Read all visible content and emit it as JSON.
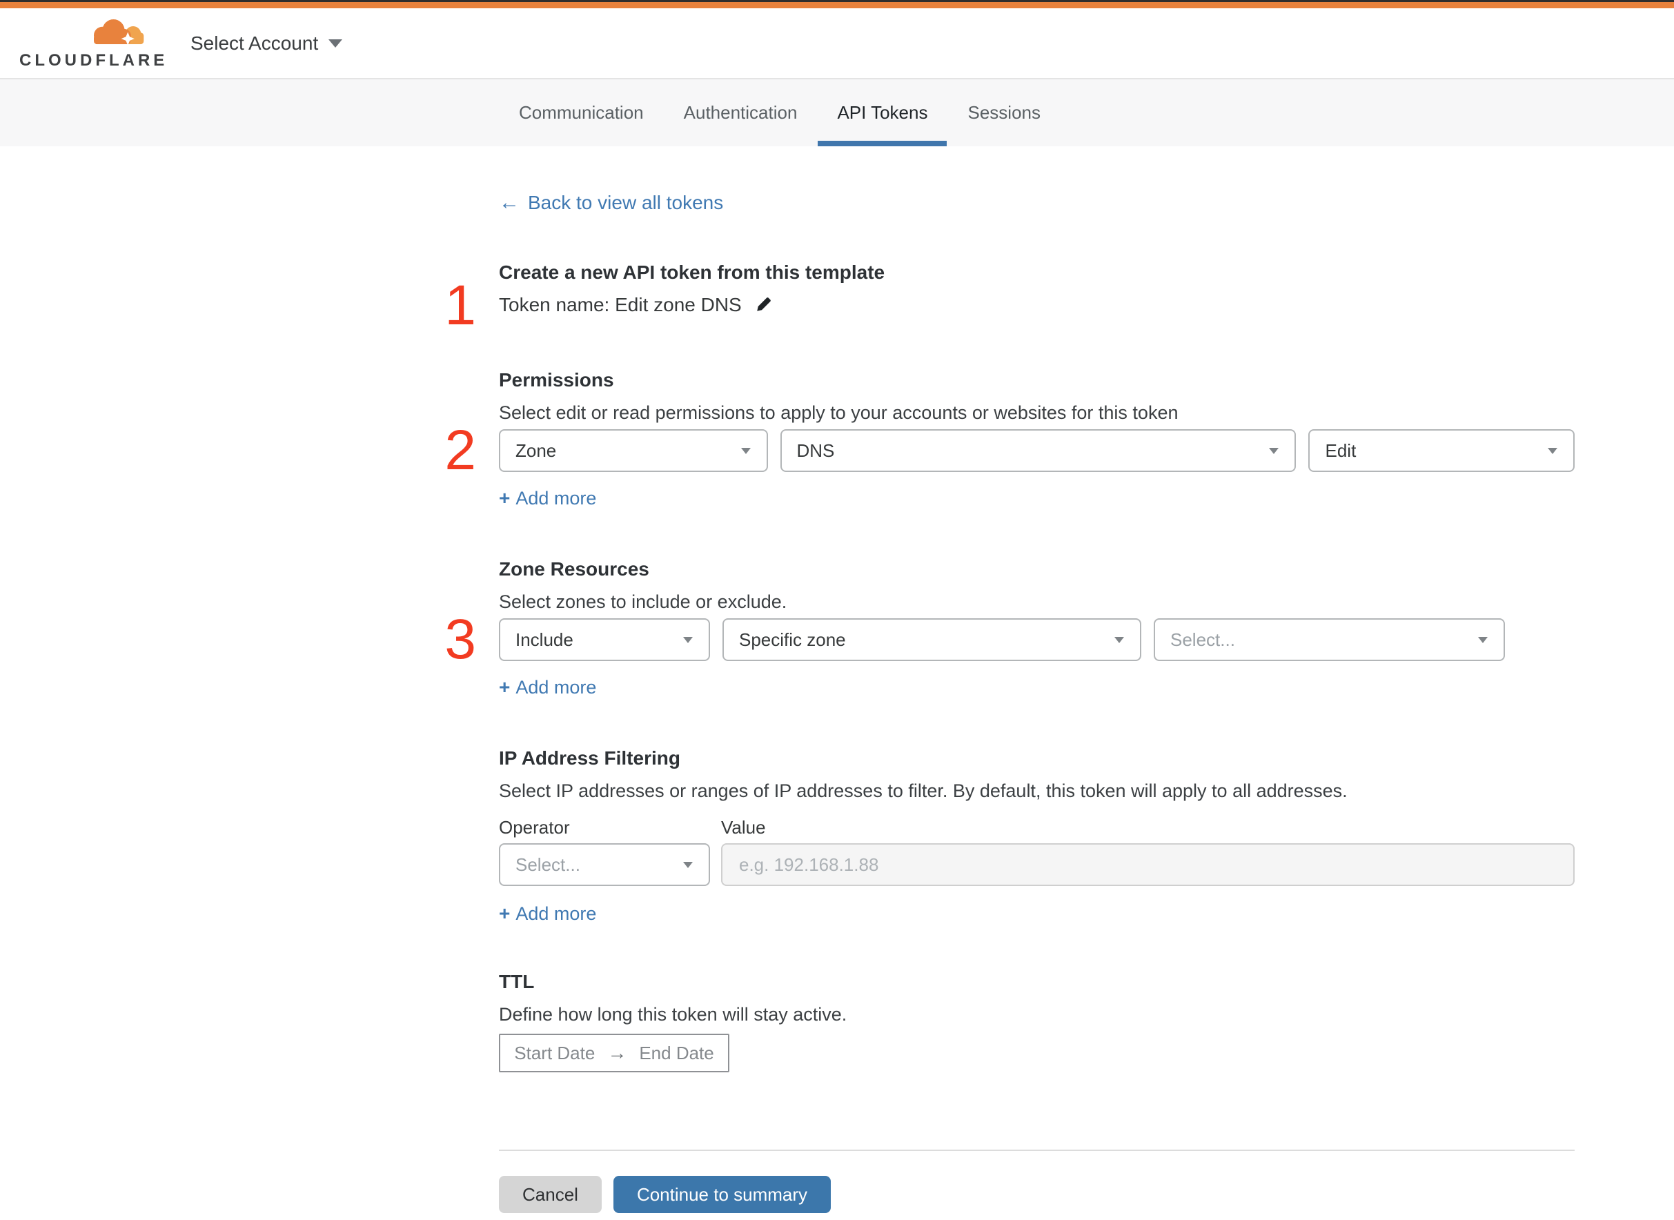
{
  "header": {
    "brand": "CLOUDFLARE",
    "account_selector": "Select Account"
  },
  "tabs": {
    "items": [
      {
        "label": "Communication"
      },
      {
        "label": "Authentication"
      },
      {
        "label": "API Tokens"
      },
      {
        "label": "Sessions"
      }
    ],
    "active": "API Tokens"
  },
  "back_link": {
    "arrow": "←",
    "label": "Back to view all tokens"
  },
  "steps": {
    "one": "1",
    "two": "2",
    "three": "3"
  },
  "template_section": {
    "heading": "Create a new API token from this template",
    "token_name": "Token name: Edit zone DNS"
  },
  "permissions": {
    "heading": "Permissions",
    "description": "Select edit or read permissions to apply to your accounts or websites for this token",
    "scope_select": "Zone",
    "resource_select": "DNS",
    "access_select": "Edit",
    "plus": "+",
    "add_more": "Add more"
  },
  "zone_resources": {
    "heading": "Zone Resources",
    "description": "Select zones to include or exclude.",
    "mode_select": "Include",
    "type_select": "Specific zone",
    "zone_select_placeholder": "Select...",
    "plus": "+",
    "add_more": "Add more"
  },
  "ip_filtering": {
    "heading": "IP Address Filtering",
    "description": "Select IP addresses or ranges of IP addresses to filter. By default, this token will apply to all addresses.",
    "operator_label": "Operator",
    "value_label": "Value",
    "operator_placeholder": "Select...",
    "value_placeholder": "e.g. 192.168.1.88",
    "plus": "+",
    "add_more": "Add more"
  },
  "ttl": {
    "heading": "TTL",
    "description": "Define how long this token will stay active.",
    "start_placeholder": "Start Date",
    "arrow": "→",
    "end_placeholder": "End Date"
  },
  "footer": {
    "cancel": "Cancel",
    "continue": "Continue to summary"
  },
  "colors": {
    "brand_orange": "#e8823d",
    "brand_orange_light": "#f0a44e",
    "link_blue": "#4079b2",
    "button_blue": "#3c77ab",
    "tab_underline": "#4076ac",
    "annotation_red": "#f23b21"
  }
}
